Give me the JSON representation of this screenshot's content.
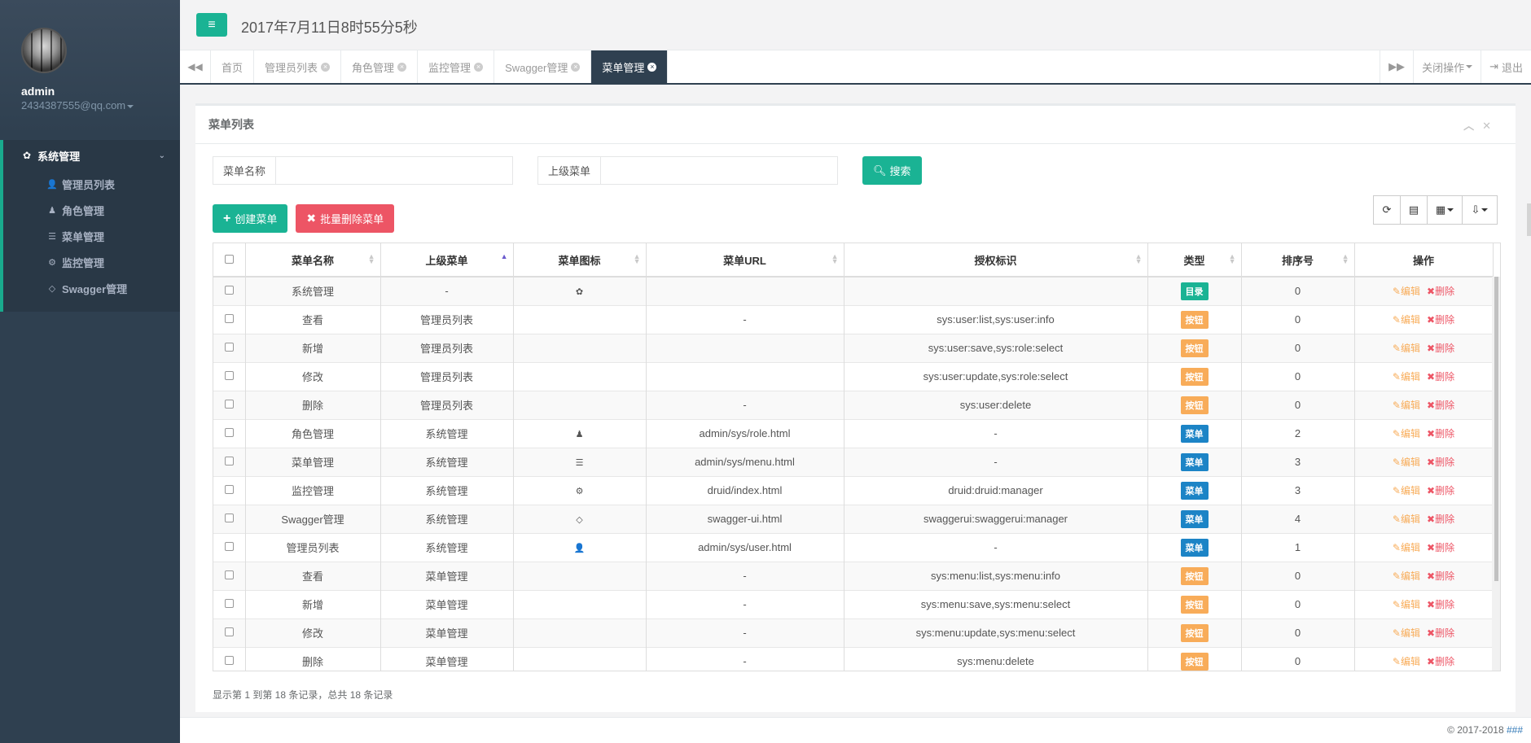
{
  "profile": {
    "name": "admin",
    "email": "2434387555@qq.com"
  },
  "nav": {
    "group_label": "系统管理",
    "items": [
      {
        "label": "管理员列表",
        "icon": "user-icon"
      },
      {
        "label": "角色管理",
        "icon": "user-secret-icon"
      },
      {
        "label": "菜单管理",
        "icon": "list-icon"
      },
      {
        "label": "监控管理",
        "icon": "cogs-icon"
      },
      {
        "label": "Swagger管理",
        "icon": "diamond-icon"
      }
    ]
  },
  "topbar": {
    "clock": "2017年7月11日8时55分5秒"
  },
  "tabs": [
    {
      "label": "首页",
      "closable": false
    },
    {
      "label": "管理员列表",
      "closable": true
    },
    {
      "label": "角色管理",
      "closable": true
    },
    {
      "label": "监控管理",
      "closable": true
    },
    {
      "label": "Swagger管理",
      "closable": true
    },
    {
      "label": "菜单管理",
      "closable": true,
      "active": true
    }
  ],
  "tab_actions": {
    "close_ops": "关闭操作",
    "logout": "退出"
  },
  "panel": {
    "title": "菜单列表"
  },
  "search": {
    "menu_name_label": "菜单名称",
    "parent_menu_label": "上级菜单",
    "search_button": "搜索"
  },
  "actions": {
    "create": "创建菜单",
    "batch_delete": "批量删除菜单"
  },
  "table": {
    "headers": [
      "菜单名称",
      "上级菜单",
      "菜单图标",
      "菜单URL",
      "授权标识",
      "类型",
      "排序号",
      "操作"
    ],
    "edit_label": "编辑",
    "delete_label": "删除",
    "rows": [
      {
        "name": "系统管理",
        "parent": "-",
        "icon": "gear-icon",
        "url": "",
        "perms": "",
        "type": "目录",
        "type_color": "#1ab394",
        "order": "0"
      },
      {
        "name": "查看",
        "parent": "管理员列表",
        "icon": "",
        "url": "-",
        "perms": "sys:user:list,sys:user:info",
        "type": "按钮",
        "type_color": "#f8ac59",
        "order": "0"
      },
      {
        "name": "新增",
        "parent": "管理员列表",
        "icon": "",
        "url": "",
        "perms": "sys:user:save,sys:role:select",
        "type": "按钮",
        "type_color": "#f8ac59",
        "order": "0"
      },
      {
        "name": "修改",
        "parent": "管理员列表",
        "icon": "",
        "url": "",
        "perms": "sys:user:update,sys:role:select",
        "type": "按钮",
        "type_color": "#f8ac59",
        "order": "0"
      },
      {
        "name": "删除",
        "parent": "管理员列表",
        "icon": "",
        "url": "-",
        "perms": "sys:user:delete",
        "type": "按钮",
        "type_color": "#f8ac59",
        "order": "0"
      },
      {
        "name": "角色管理",
        "parent": "系统管理",
        "icon": "user-secret-icon",
        "url": "admin/sys/role.html",
        "perms": "-",
        "type": "菜单",
        "type_color": "#1c84c6",
        "order": "2"
      },
      {
        "name": "菜单管理",
        "parent": "系统管理",
        "icon": "list-icon",
        "url": "admin/sys/menu.html",
        "perms": "-",
        "type": "菜单",
        "type_color": "#1c84c6",
        "order": "3"
      },
      {
        "name": "监控管理",
        "parent": "系统管理",
        "icon": "cogs-icon",
        "url": "druid/index.html",
        "perms": "druid:druid:manager",
        "type": "菜单",
        "type_color": "#1c84c6",
        "order": "3"
      },
      {
        "name": "Swagger管理",
        "parent": "系统管理",
        "icon": "diamond-icon",
        "url": "swagger-ui.html",
        "perms": "swaggerui:swaggerui:manager",
        "type": "菜单",
        "type_color": "#1c84c6",
        "order": "4"
      },
      {
        "name": "管理员列表",
        "parent": "系统管理",
        "icon": "user-icon",
        "url": "admin/sys/user.html",
        "perms": "-",
        "type": "菜单",
        "type_color": "#1c84c6",
        "order": "1"
      },
      {
        "name": "查看",
        "parent": "菜单管理",
        "icon": "",
        "url": "-",
        "perms": "sys:menu:list,sys:menu:info",
        "type": "按钮",
        "type_color": "#f8ac59",
        "order": "0"
      },
      {
        "name": "新增",
        "parent": "菜单管理",
        "icon": "",
        "url": "-",
        "perms": "sys:menu:save,sys:menu:select",
        "type": "按钮",
        "type_color": "#f8ac59",
        "order": "0"
      },
      {
        "name": "修改",
        "parent": "菜单管理",
        "icon": "",
        "url": "-",
        "perms": "sys:menu:update,sys:menu:select",
        "type": "按钮",
        "type_color": "#f8ac59",
        "order": "0"
      },
      {
        "name": "删除",
        "parent": "菜单管理",
        "icon": "",
        "url": "-",
        "perms": "sys:menu:delete",
        "type": "按钮",
        "type_color": "#f8ac59",
        "order": "0"
      }
    ]
  },
  "pagination": {
    "summary": "显示第 1 到第 18 条记录，总共 18 条记录"
  },
  "footer": {
    "copyright": "© 2017-2018 ",
    "link": "###"
  }
}
